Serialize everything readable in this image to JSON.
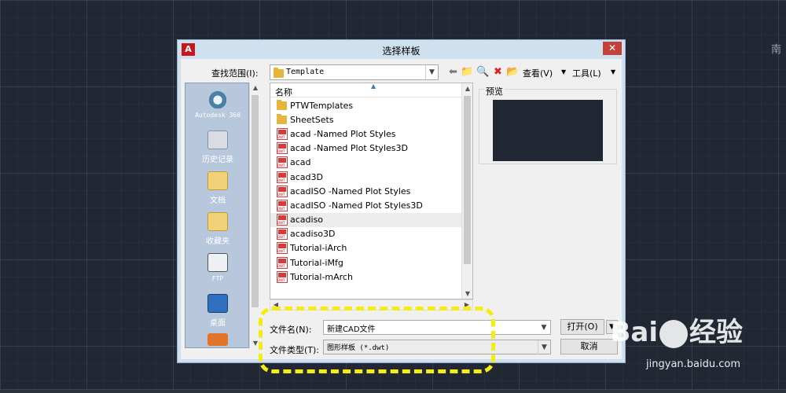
{
  "background": {
    "corner_glyph": "南"
  },
  "dialog": {
    "title": "选择样板",
    "app_icon": "A",
    "close_label": "✕",
    "lookin": {
      "label": "查找范围(I):",
      "value": "Template"
    },
    "toolbar": {
      "back_icon": "⬅",
      "up_folder_icon": "📁",
      "search_web_icon": "🔍",
      "delete_icon": "✖",
      "new_folder_icon": "📂",
      "views_label": "查看(V)",
      "tools_label": "工具(L)",
      "dropdown_arrow": "▼"
    },
    "places": [
      {
        "label": "Autodesk 360",
        "icon": "cloud-icon"
      },
      {
        "label": "历史记录",
        "icon": "history-icon"
      },
      {
        "label": "文档",
        "icon": "documents-icon"
      },
      {
        "label": "收藏夹",
        "icon": "favorites-icon"
      },
      {
        "label": "FTP",
        "icon": "ftp-icon"
      },
      {
        "label": "桌面",
        "icon": "desktop-icon"
      }
    ],
    "file_list": {
      "column_name": "名称",
      "items": [
        {
          "name": "PTWTemplates",
          "type": "folder"
        },
        {
          "name": "SheetSets",
          "type": "folder"
        },
        {
          "name": "acad -Named Plot Styles",
          "type": "dwt"
        },
        {
          "name": "acad -Named Plot Styles3D",
          "type": "dwt"
        },
        {
          "name": "acad",
          "type": "dwt"
        },
        {
          "name": "acad3D",
          "type": "dwt"
        },
        {
          "name": "acadISO -Named Plot Styles",
          "type": "dwt"
        },
        {
          "name": "acadISO -Named Plot Styles3D",
          "type": "dwt"
        },
        {
          "name": "acadiso",
          "type": "dwt",
          "selected": true
        },
        {
          "name": "acadiso3D",
          "type": "dwt"
        },
        {
          "name": "Tutorial-iArch",
          "type": "dwt"
        },
        {
          "name": "Tutorial-iMfg",
          "type": "dwt"
        },
        {
          "name": "Tutorial-mArch",
          "type": "dwt"
        }
      ]
    },
    "preview_label": "预览",
    "filename": {
      "label": "文件名(N):",
      "value": "新建CAD文件"
    },
    "filetype": {
      "label": "文件类型(T):",
      "value": "图形样板 (*.dwt)"
    },
    "open_button": "打开(O)",
    "cancel_button": "取消"
  },
  "watermark": {
    "text_left": "Bai",
    "text_right": "经验",
    "url": "jingyan.baidu.com"
  },
  "colors": {
    "highlight": "#f4ec13",
    "canvas": "#212833",
    "close": "#c4413a"
  }
}
